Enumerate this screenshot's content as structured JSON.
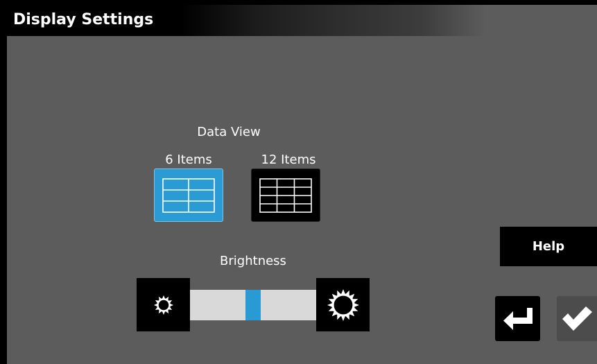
{
  "window": {
    "title": "Display Settings"
  },
  "data_view": {
    "label": "Data View",
    "options": [
      {
        "label": "6 Items",
        "selected": true,
        "icon": "grid-2x3-icon"
      },
      {
        "label": "12 Items",
        "selected": false,
        "icon": "grid-3x4-icon"
      }
    ]
  },
  "brightness": {
    "label": "Brightness",
    "level_fraction": 0.5,
    "decrease_icon": "sun-small-icon",
    "increase_icon": "sun-large-icon"
  },
  "buttons": {
    "help_label": "Help",
    "back_icon": "return-arrow-icon",
    "ok_icon": "checkmark-icon"
  },
  "colors": {
    "accent": "#2b9bd6",
    "background": "#5c5c5c",
    "button": "#000000"
  }
}
